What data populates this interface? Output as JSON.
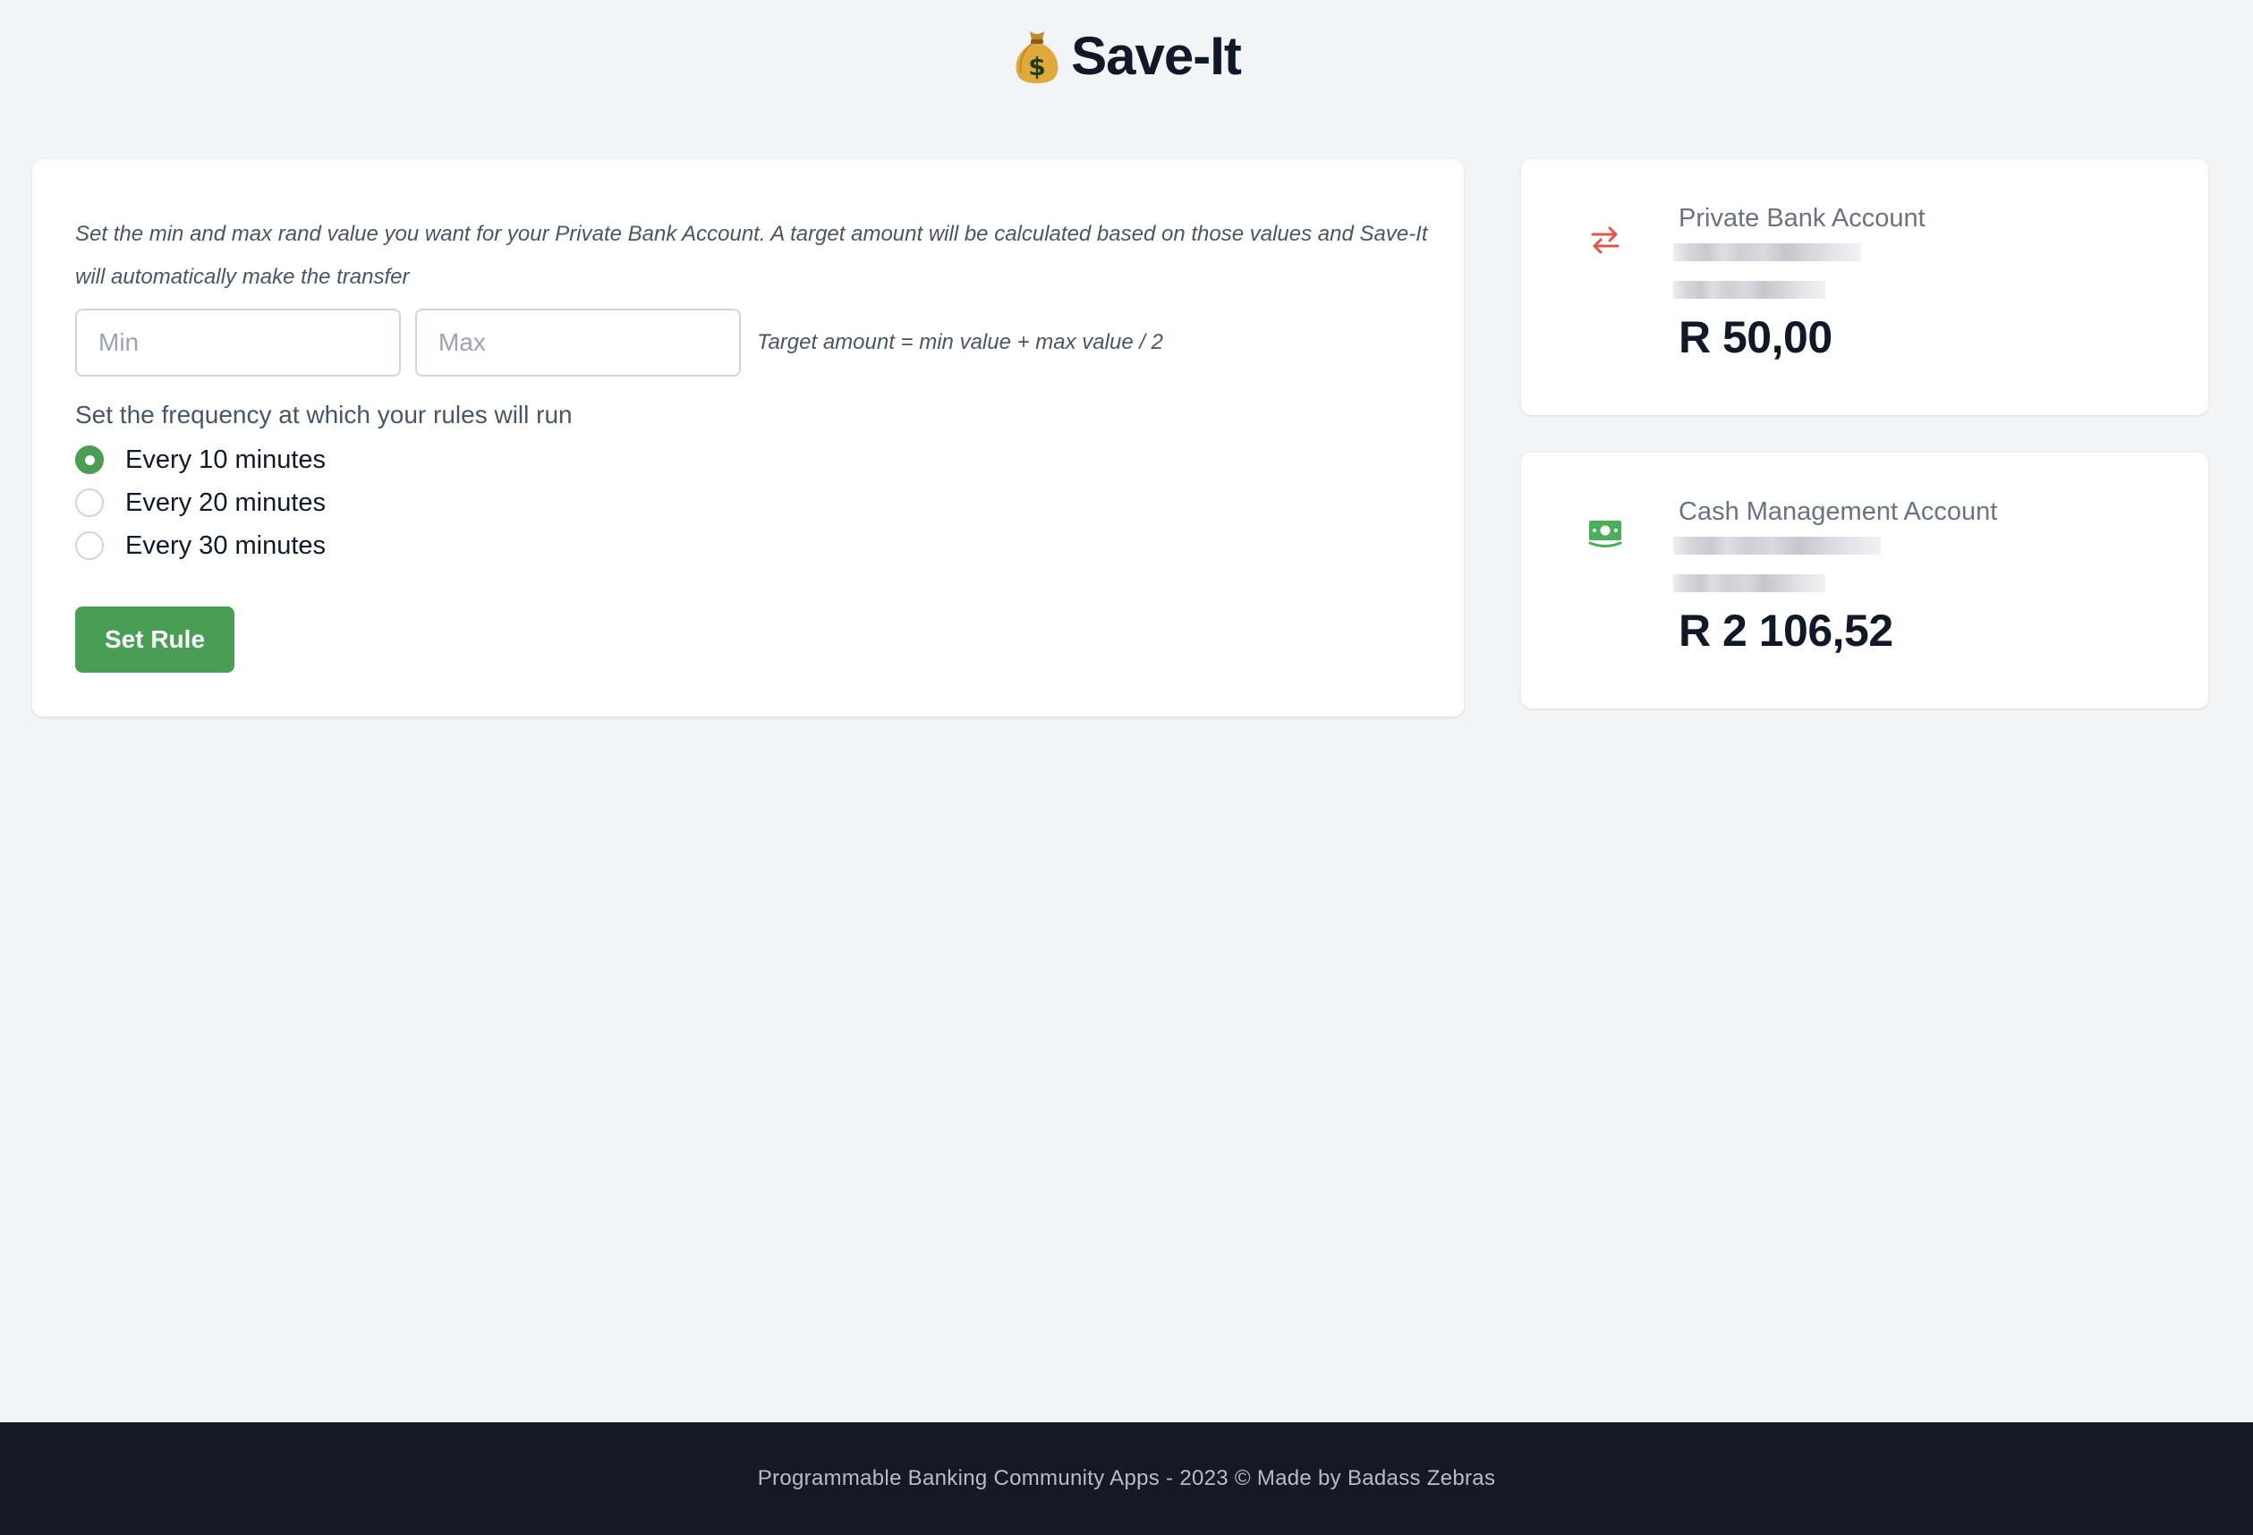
{
  "header": {
    "logo_icon": "money-bag-icon",
    "title": "Save-It"
  },
  "rule_form": {
    "description": "Set the min and max rand value you want for your Private Bank Account. A target amount will be calculated based on those values and Save-It will automatically make the transfer",
    "min_input": {
      "placeholder": "Min",
      "value": ""
    },
    "max_input": {
      "placeholder": "Max",
      "value": ""
    },
    "formula": "Target amount = min value + max value / 2",
    "frequency_label": "Set the frequency at which your rules will run",
    "frequency_options": [
      {
        "label": "Every 10 minutes",
        "selected": true
      },
      {
        "label": "Every 20 minutes",
        "selected": false
      },
      {
        "label": "Every 30 minutes",
        "selected": false
      }
    ],
    "submit_label": "Set Rule"
  },
  "accounts": [
    {
      "name": "Private Bank Account",
      "icon": "transfer-arrows-icon",
      "icon_color": "#e0554d",
      "balance": "R 50,00"
    },
    {
      "name": "Cash Management Account",
      "icon": "banknote-icon",
      "icon_color": "#4aae5c",
      "balance": "R 2 106,52"
    }
  ],
  "footer": {
    "text": "Programmable Banking Community Apps - 2023 © Made by Badass Zebras"
  },
  "colors": {
    "accent_green": "#4a9d55",
    "background": "#f3f4f6",
    "footer_bg": "#141926",
    "text_dark": "#111827",
    "text_muted": "#6b7280"
  }
}
